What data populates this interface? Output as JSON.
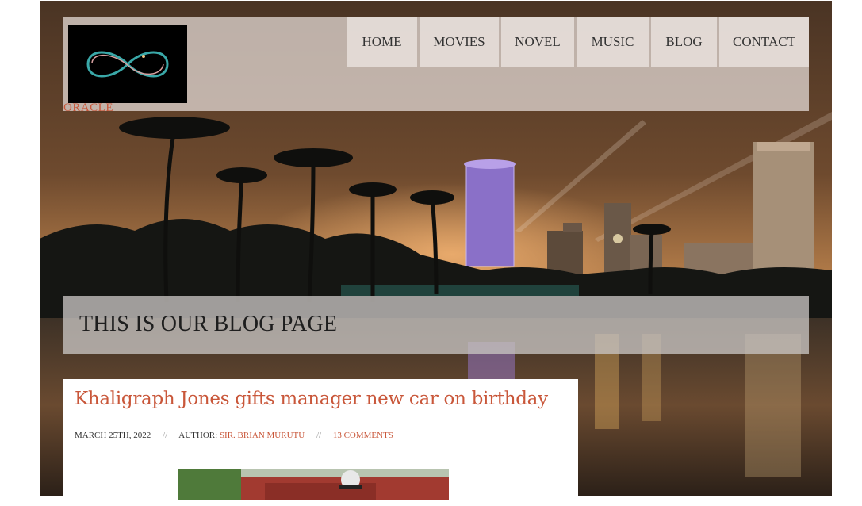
{
  "site": {
    "name": "ORACLE",
    "logo_icon": "infinity-icon"
  },
  "nav": {
    "items": [
      {
        "label": "HOME"
      },
      {
        "label": "MOVIES"
      },
      {
        "label": "NOVEL"
      },
      {
        "label": "MUSIC"
      },
      {
        "label": "BLOG"
      },
      {
        "label": "CONTACT"
      }
    ]
  },
  "banner": {
    "title": "THIS IS OUR BLOG PAGE"
  },
  "post": {
    "title": "Khaligraph Jones gifts manager new car on birthday",
    "date": "MARCH 25TH, 2022",
    "author_prefix": "AUTHOR:",
    "author": "SIR. BRIAN MURUTU",
    "separator": "//",
    "comments": "13 COMMENTS"
  },
  "colors": {
    "accent": "#c9573a",
    "header_bg": "#ded4ce",
    "text": "#333333"
  }
}
